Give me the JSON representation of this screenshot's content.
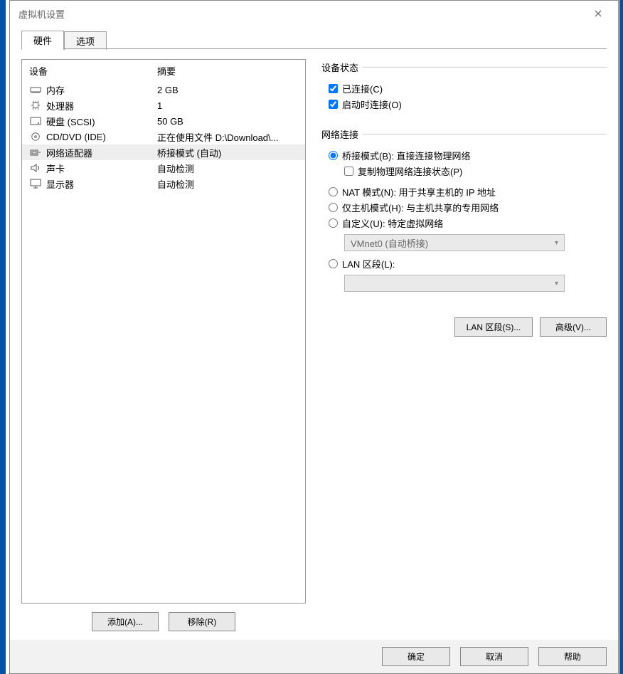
{
  "window": {
    "title": "虚拟机设置"
  },
  "tabs": {
    "hardware": "硬件",
    "options": "选项"
  },
  "headers": {
    "device": "设备",
    "summary": "摘要"
  },
  "devices": [
    {
      "icon": "memory-icon",
      "name": "内存",
      "summary": "2 GB"
    },
    {
      "icon": "cpu-icon",
      "name": "处理器",
      "summary": "1"
    },
    {
      "icon": "disk-icon",
      "name": "硬盘 (SCSI)",
      "summary": "50 GB"
    },
    {
      "icon": "cd-icon",
      "name": "CD/DVD (IDE)",
      "summary": "正在使用文件 D:\\Download\\..."
    },
    {
      "icon": "nic-icon",
      "name": "网络适配器",
      "summary": "桥接模式 (自动)",
      "selected": true
    },
    {
      "icon": "sound-icon",
      "name": "声卡",
      "summary": "自动检测"
    },
    {
      "icon": "display-icon",
      "name": "显示器",
      "summary": "自动检测"
    }
  ],
  "buttons": {
    "add": "添加(A)...",
    "remove": "移除(R)",
    "lan_segments": "LAN 区段(S)...",
    "advanced": "高级(V)...",
    "ok": "确定",
    "cancel": "取消",
    "help": "帮助"
  },
  "device_state": {
    "title": "设备状态",
    "connected": "已连接(C)",
    "connect_at_power_on": "启动时连接(O)"
  },
  "network": {
    "title": "网络连接",
    "bridged": "桥接模式(B): 直接连接物理网络",
    "replicate": "复制物理网络连接状态(P)",
    "nat": "NAT 模式(N): 用于共享主机的 IP 地址",
    "host_only": "仅主机模式(H): 与主机共享的专用网络",
    "custom": "自定义(U): 特定虚拟网络",
    "custom_combo": "VMnet0 (自动桥接)",
    "lan_segment": "LAN 区段(L):",
    "lan_combo": ""
  }
}
